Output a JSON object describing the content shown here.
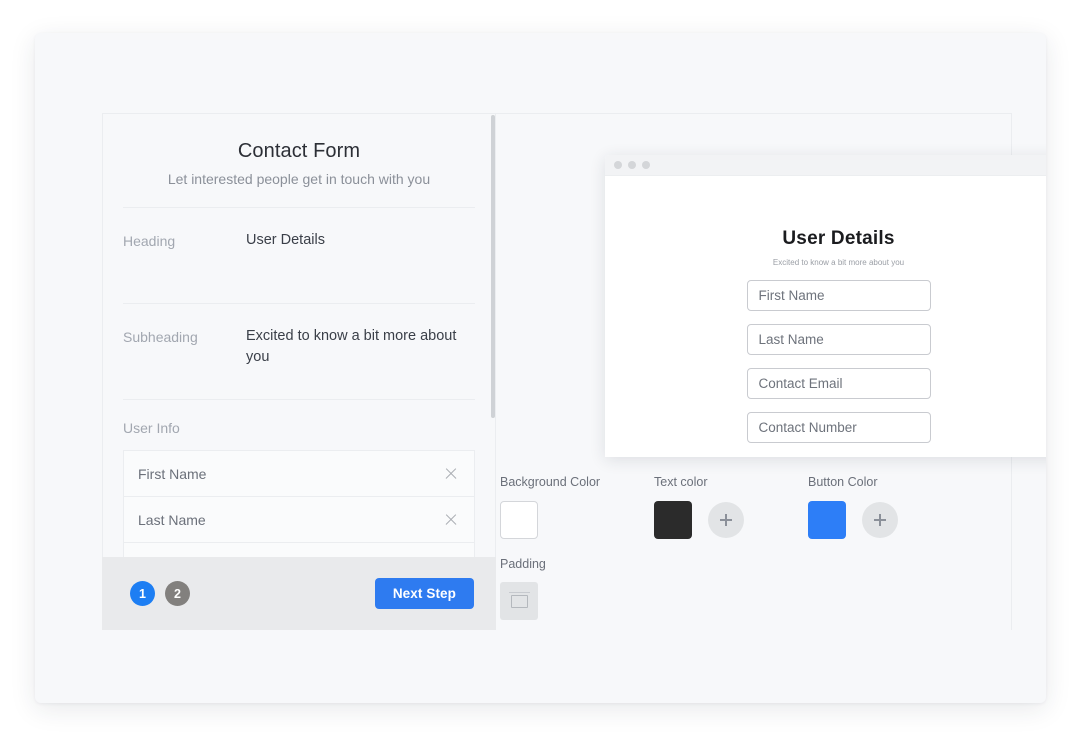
{
  "editor": {
    "title": "Contact Form",
    "subtitle": "Let interested people get in touch with you",
    "fields": [
      {
        "label": "Heading",
        "value": "User Details"
      },
      {
        "label": "Subheading",
        "value": "Excited to know a bit more about you"
      }
    ],
    "section": {
      "label": "User Info"
    },
    "items": [
      {
        "name": "First Name",
        "remove_icon": "close-icon"
      },
      {
        "name": "Last Name",
        "remove_icon": "close-icon"
      }
    ],
    "footer": {
      "steps": [
        {
          "number": "1",
          "state": "active"
        },
        {
          "number": "2",
          "state": "inactive"
        }
      ],
      "next_label": "Next Step",
      "next_color": "#2e7bf0",
      "active_step_color": "#1d7ef3",
      "inactive_step_color": "#82807e"
    }
  },
  "preview": {
    "window_dots": [
      "window-dot",
      "window-dot",
      "window-dot"
    ],
    "title": "User Details",
    "subtitle": "Excited to know a bit more about you",
    "inputs": [
      {
        "placeholder": "First Name"
      },
      {
        "placeholder": "Last Name"
      },
      {
        "placeholder": "Contact Email"
      },
      {
        "placeholder": "Contact Number"
      }
    ]
  },
  "style_controls": {
    "background_color": {
      "label": "Background Color",
      "value": "#ffffff"
    },
    "text_color": {
      "label": "Text color",
      "value": "#2b2b2b",
      "add_label": "+"
    },
    "button_color": {
      "label": "Button Color",
      "value": "#2d7ef7",
      "add_label": "+"
    },
    "padding": {
      "label": "Padding",
      "icon": "padding-icon"
    }
  }
}
